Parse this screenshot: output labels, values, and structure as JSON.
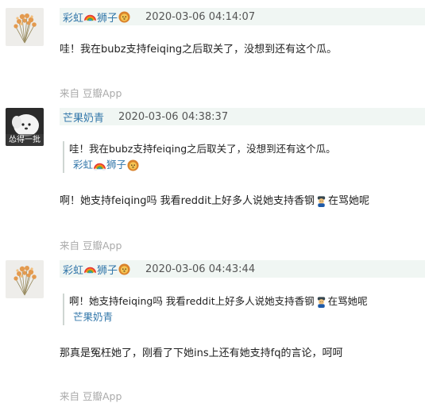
{
  "comments": [
    {
      "author_name": "彩虹",
      "author_suffix": "狮子",
      "timestamp": "2020-03-06 04:14:07",
      "text": "哇！我在bubz支持feiqing之后取关了，没想到还有这个瓜。",
      "source_label": "来自 豆瓣App"
    },
    {
      "author_name": "芒果奶青",
      "timestamp": "2020-03-06 04:38:37",
      "avatar_caption": "怂得一批",
      "quote_text": "哇！我在bubz支持feiqing之后取关了，没想到还有这个瓜。",
      "quote_author_name": "彩虹",
      "quote_author_suffix": "狮子",
      "text_before": "啊！她支持feiqing吗 我看reddit上好多人说她支持香钢",
      "text_after": "在骂她呢",
      "source_label": "来自 豆瓣App"
    },
    {
      "author_name": "彩虹",
      "author_suffix": "狮子",
      "timestamp": "2020-03-06 04:43:44",
      "quote_before": "啊！她支持feiqing吗 我看reddit上好多人说她支持香钢",
      "quote_after": "在骂她呢",
      "quote_author_name": "芒果奶青",
      "text": "那真是冤枉她了，刚看了下她ins上还有她支持fq的言论，呵呵",
      "source_label": "来自 豆瓣App"
    }
  ],
  "colors": {
    "link": "#3377aa",
    "header_bg": "#f0f6f3",
    "source": "#aaaaaa"
  }
}
